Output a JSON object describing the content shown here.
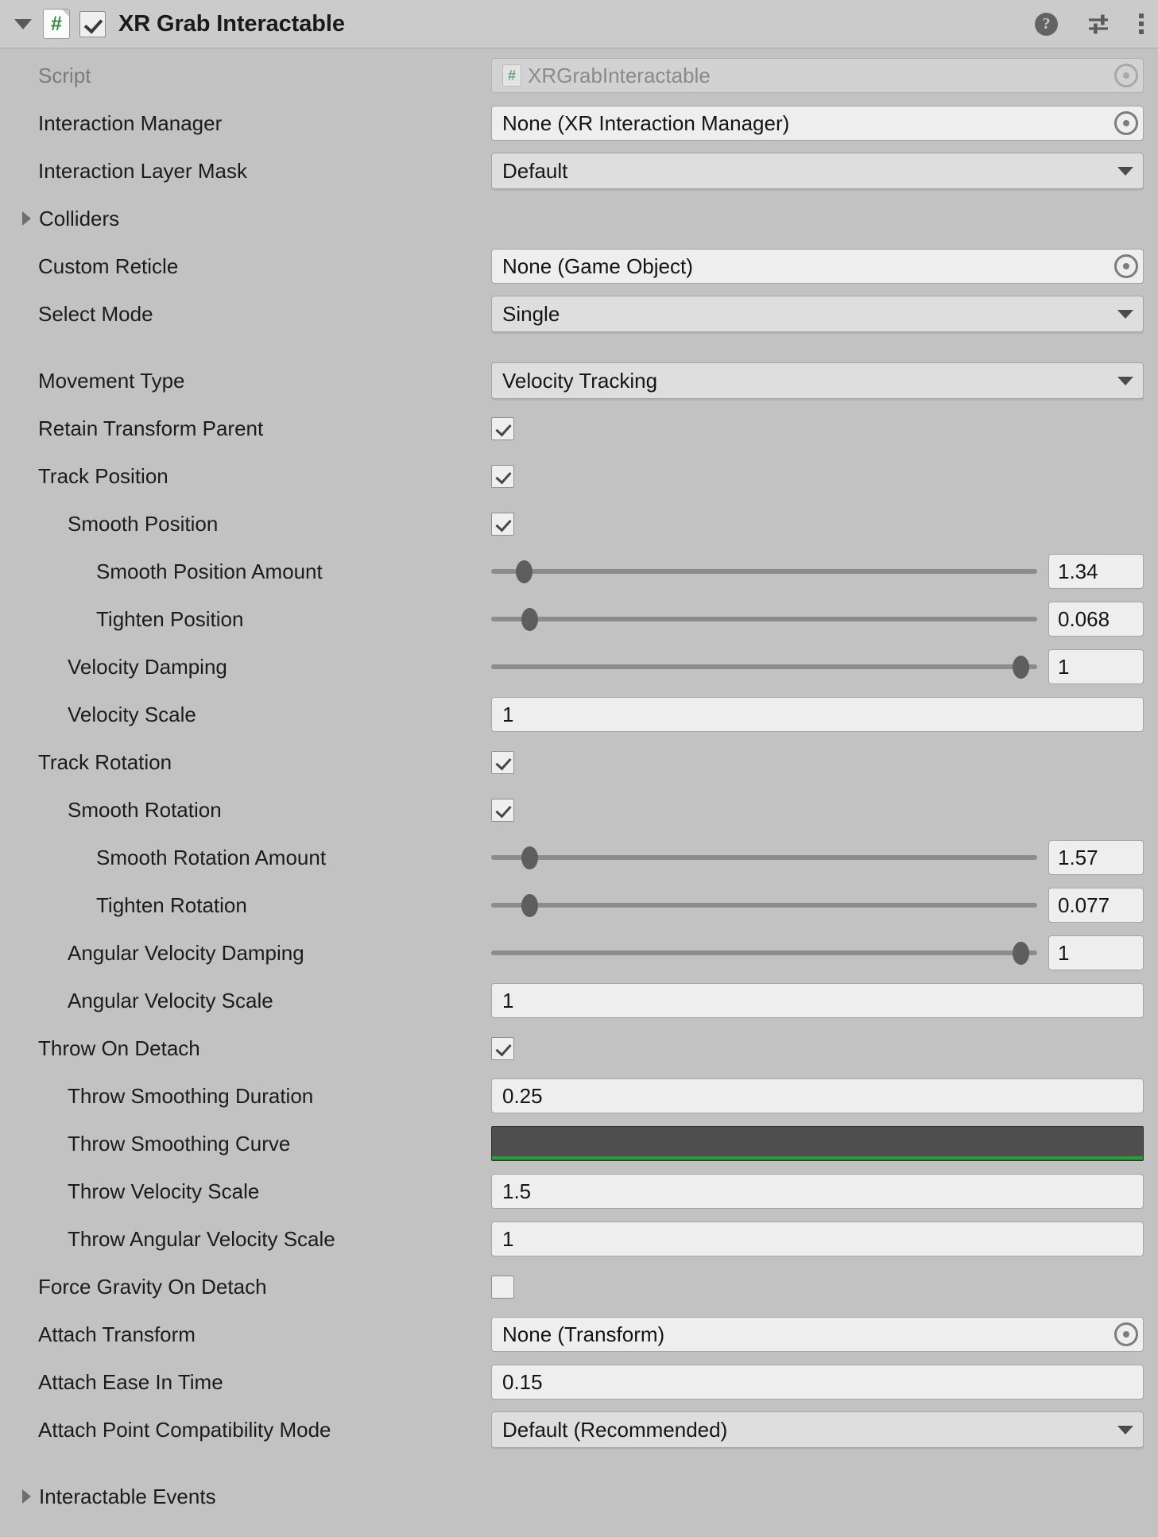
{
  "header": {
    "title": "XR Grab Interactable",
    "enabled_checkbox": true,
    "script_glyph": "#",
    "icons": {
      "help": "?",
      "help_name": "help-icon",
      "preset": "preset-icon",
      "menu": "kebab-menu-icon"
    }
  },
  "rows": [
    {
      "label": "Script",
      "type": "object",
      "value": "XRGrabInteractable",
      "disabled": true,
      "indent": 0,
      "name": "script"
    },
    {
      "label": "Interaction Manager",
      "type": "object",
      "value": "None (XR Interaction Manager)",
      "disabled": false,
      "indent": 0,
      "name": "interaction-manager"
    },
    {
      "label": "Interaction Layer Mask",
      "type": "dropdown",
      "value": "Default",
      "indent": 0,
      "name": "interaction-layer-mask"
    },
    {
      "label": "Colliders",
      "type": "foldout",
      "expanded": false,
      "indent": 0,
      "name": "colliders"
    },
    {
      "label": "Custom Reticle",
      "type": "object",
      "value": "None (Game Object)",
      "disabled": false,
      "indent": 0,
      "name": "custom-reticle"
    },
    {
      "label": "Select Mode",
      "type": "dropdown",
      "value": "Single",
      "indent": 0,
      "name": "select-mode"
    },
    {
      "label": "Movement Type",
      "type": "dropdown",
      "value": "Velocity Tracking",
      "indent": 0,
      "gap": true,
      "name": "movement-type"
    },
    {
      "label": "Retain Transform Parent",
      "type": "checkbox",
      "value": true,
      "indent": 0,
      "name": "retain-transform-parent"
    },
    {
      "label": "Track Position",
      "type": "checkbox",
      "value": true,
      "indent": 0,
      "name": "track-position"
    },
    {
      "label": "Smooth Position",
      "type": "checkbox",
      "value": true,
      "indent": 1,
      "name": "smooth-position"
    },
    {
      "label": "Smooth Position Amount",
      "type": "slider",
      "value": "1.34",
      "fill": 6,
      "indent": 2,
      "name": "smooth-position-amount"
    },
    {
      "label": "Tighten Position",
      "type": "slider",
      "value": "0.068",
      "fill": 7,
      "indent": 2,
      "name": "tighten-position"
    },
    {
      "label": "Velocity Damping",
      "type": "slider",
      "value": "1",
      "fill": 97,
      "indent": 1,
      "name": "velocity-damping"
    },
    {
      "label": "Velocity Scale",
      "type": "text",
      "value": "1",
      "indent": 1,
      "name": "velocity-scale"
    },
    {
      "label": "Track Rotation",
      "type": "checkbox",
      "value": true,
      "indent": 0,
      "name": "track-rotation"
    },
    {
      "label": "Smooth Rotation",
      "type": "checkbox",
      "value": true,
      "indent": 1,
      "name": "smooth-rotation"
    },
    {
      "label": "Smooth Rotation Amount",
      "type": "slider",
      "value": "1.57",
      "fill": 7,
      "indent": 2,
      "name": "smooth-rotation-amount"
    },
    {
      "label": "Tighten Rotation",
      "type": "slider",
      "value": "0.077",
      "fill": 7,
      "indent": 2,
      "name": "tighten-rotation"
    },
    {
      "label": "Angular Velocity Damping",
      "type": "slider",
      "value": "1",
      "fill": 97,
      "indent": 1,
      "name": "angular-velocity-damping"
    },
    {
      "label": "Angular Velocity Scale",
      "type": "text",
      "value": "1",
      "indent": 1,
      "name": "angular-velocity-scale"
    },
    {
      "label": "Throw On Detach",
      "type": "checkbox",
      "value": true,
      "indent": 0,
      "name": "throw-on-detach"
    },
    {
      "label": "Throw Smoothing Duration",
      "type": "text",
      "value": "0.25",
      "indent": 1,
      "name": "throw-smoothing-duration"
    },
    {
      "label": "Throw Smoothing Curve",
      "type": "curve",
      "value": "",
      "indent": 1,
      "name": "throw-smoothing-curve"
    },
    {
      "label": "Throw Velocity Scale",
      "type": "text",
      "value": "1.5",
      "indent": 1,
      "name": "throw-velocity-scale"
    },
    {
      "label": "Throw Angular Velocity Scale",
      "type": "text",
      "value": "1",
      "indent": 1,
      "name": "throw-angular-velocity-scale"
    },
    {
      "label": "Force Gravity On Detach",
      "type": "checkbox",
      "value": false,
      "indent": 0,
      "name": "force-gravity-on-detach"
    },
    {
      "label": "Attach Transform",
      "type": "object",
      "value": "None (Transform)",
      "disabled": false,
      "indent": 0,
      "name": "attach-transform"
    },
    {
      "label": "Attach Ease In Time",
      "type": "text",
      "value": "0.15",
      "indent": 0,
      "name": "attach-ease-in-time"
    },
    {
      "label": "Attach Point Compatibility Mode",
      "type": "dropdown",
      "value": "Default (Recommended)",
      "indent": 0,
      "name": "attach-point-compatibility-mode"
    },
    {
      "label": "Interactable Events",
      "type": "foldout",
      "expanded": false,
      "indent": 0,
      "gap": true,
      "name": "interactable-events"
    }
  ],
  "colors": {
    "panel_bg": "#c2c2c2",
    "header_bg": "#cbcbcb",
    "field_bg": "#eeeeee",
    "dropdown_bg": "#dedede",
    "curve_line": "#1fa331",
    "script_green": "#2f8a3f",
    "text": "#1c1c1c",
    "text_dim": "#7b7b7b"
  }
}
